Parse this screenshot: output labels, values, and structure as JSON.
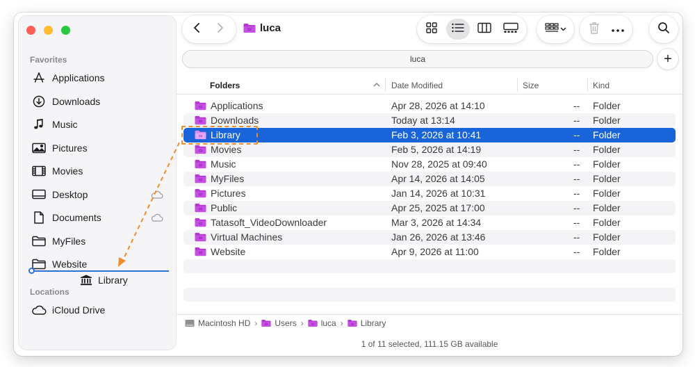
{
  "sidebar": {
    "favorites_label": "Favorites",
    "locations_label": "Locations",
    "favorites": [
      {
        "label": "Applications",
        "icon": "applications-icon"
      },
      {
        "label": "Downloads",
        "icon": "downloads-icon"
      },
      {
        "label": "Music",
        "icon": "music-note-icon"
      },
      {
        "label": "Pictures",
        "icon": "pictures-icon"
      },
      {
        "label": "Movies",
        "icon": "film-icon"
      },
      {
        "label": "Desktop",
        "icon": "desktop-icon"
      },
      {
        "label": "Documents",
        "icon": "document-icon"
      },
      {
        "label": "MyFiles",
        "icon": "folder-icon"
      },
      {
        "label": "Website",
        "icon": "folder-icon"
      }
    ],
    "drag_item": {
      "label": "Library",
      "icon": "library-icon"
    },
    "locations": [
      {
        "label": "iCloud Drive",
        "icon": "cloud-icon"
      }
    ]
  },
  "toolbar": {
    "title": "luca",
    "path_field": "luca"
  },
  "columns": {
    "name": "Folders",
    "date": "Date Modified",
    "size": "Size",
    "kind": "Kind"
  },
  "files": [
    {
      "name": "Applications",
      "date": "Apr 28, 2026 at 14:10",
      "size": "--",
      "kind": "Folder"
    },
    {
      "name": "Downloads",
      "date": "Today at 13:14",
      "size": "--",
      "kind": "Folder"
    },
    {
      "name": "Library",
      "date": "Feb 3, 2026 at 10:41",
      "size": "--",
      "kind": "Folder"
    },
    {
      "name": "Movies",
      "date": "Feb 5, 2026 at 14:19",
      "size": "--",
      "kind": "Folder"
    },
    {
      "name": "Music",
      "date": "Nov 28, 2025 at 09:40",
      "size": "--",
      "kind": "Folder"
    },
    {
      "name": "MyFiles",
      "date": "Apr 14, 2026 at 14:05",
      "size": "--",
      "kind": "Folder"
    },
    {
      "name": "Pictures",
      "date": "Jan 14, 2026 at 10:31",
      "size": "--",
      "kind": "Folder"
    },
    {
      "name": "Public",
      "date": "Apr 25, 2025 at 17:00",
      "size": "--",
      "kind": "Folder"
    },
    {
      "name": "Tatasoft_VideoDownloader",
      "date": "Mar 3, 2026 at 14:34",
      "size": "--",
      "kind": "Folder"
    },
    {
      "name": "Virtual Machines",
      "date": "Jan 26, 2026 at 13:46",
      "size": "--",
      "kind": "Folder"
    },
    {
      "name": "Website",
      "date": "Apr 9, 2026 at 11:00",
      "size": "--",
      "kind": "Folder"
    }
  ],
  "selected_index": 2,
  "breadcrumb": [
    "Macintosh HD",
    "Users",
    "luca",
    "Library"
  ],
  "status": "1 of 11 selected, 111.15 GB available",
  "colors": {
    "selection": "#1a64d9",
    "folder": "#b637d6",
    "drag_annotation": "#f08c2a",
    "drop_indicator": "#2f6fd8"
  }
}
